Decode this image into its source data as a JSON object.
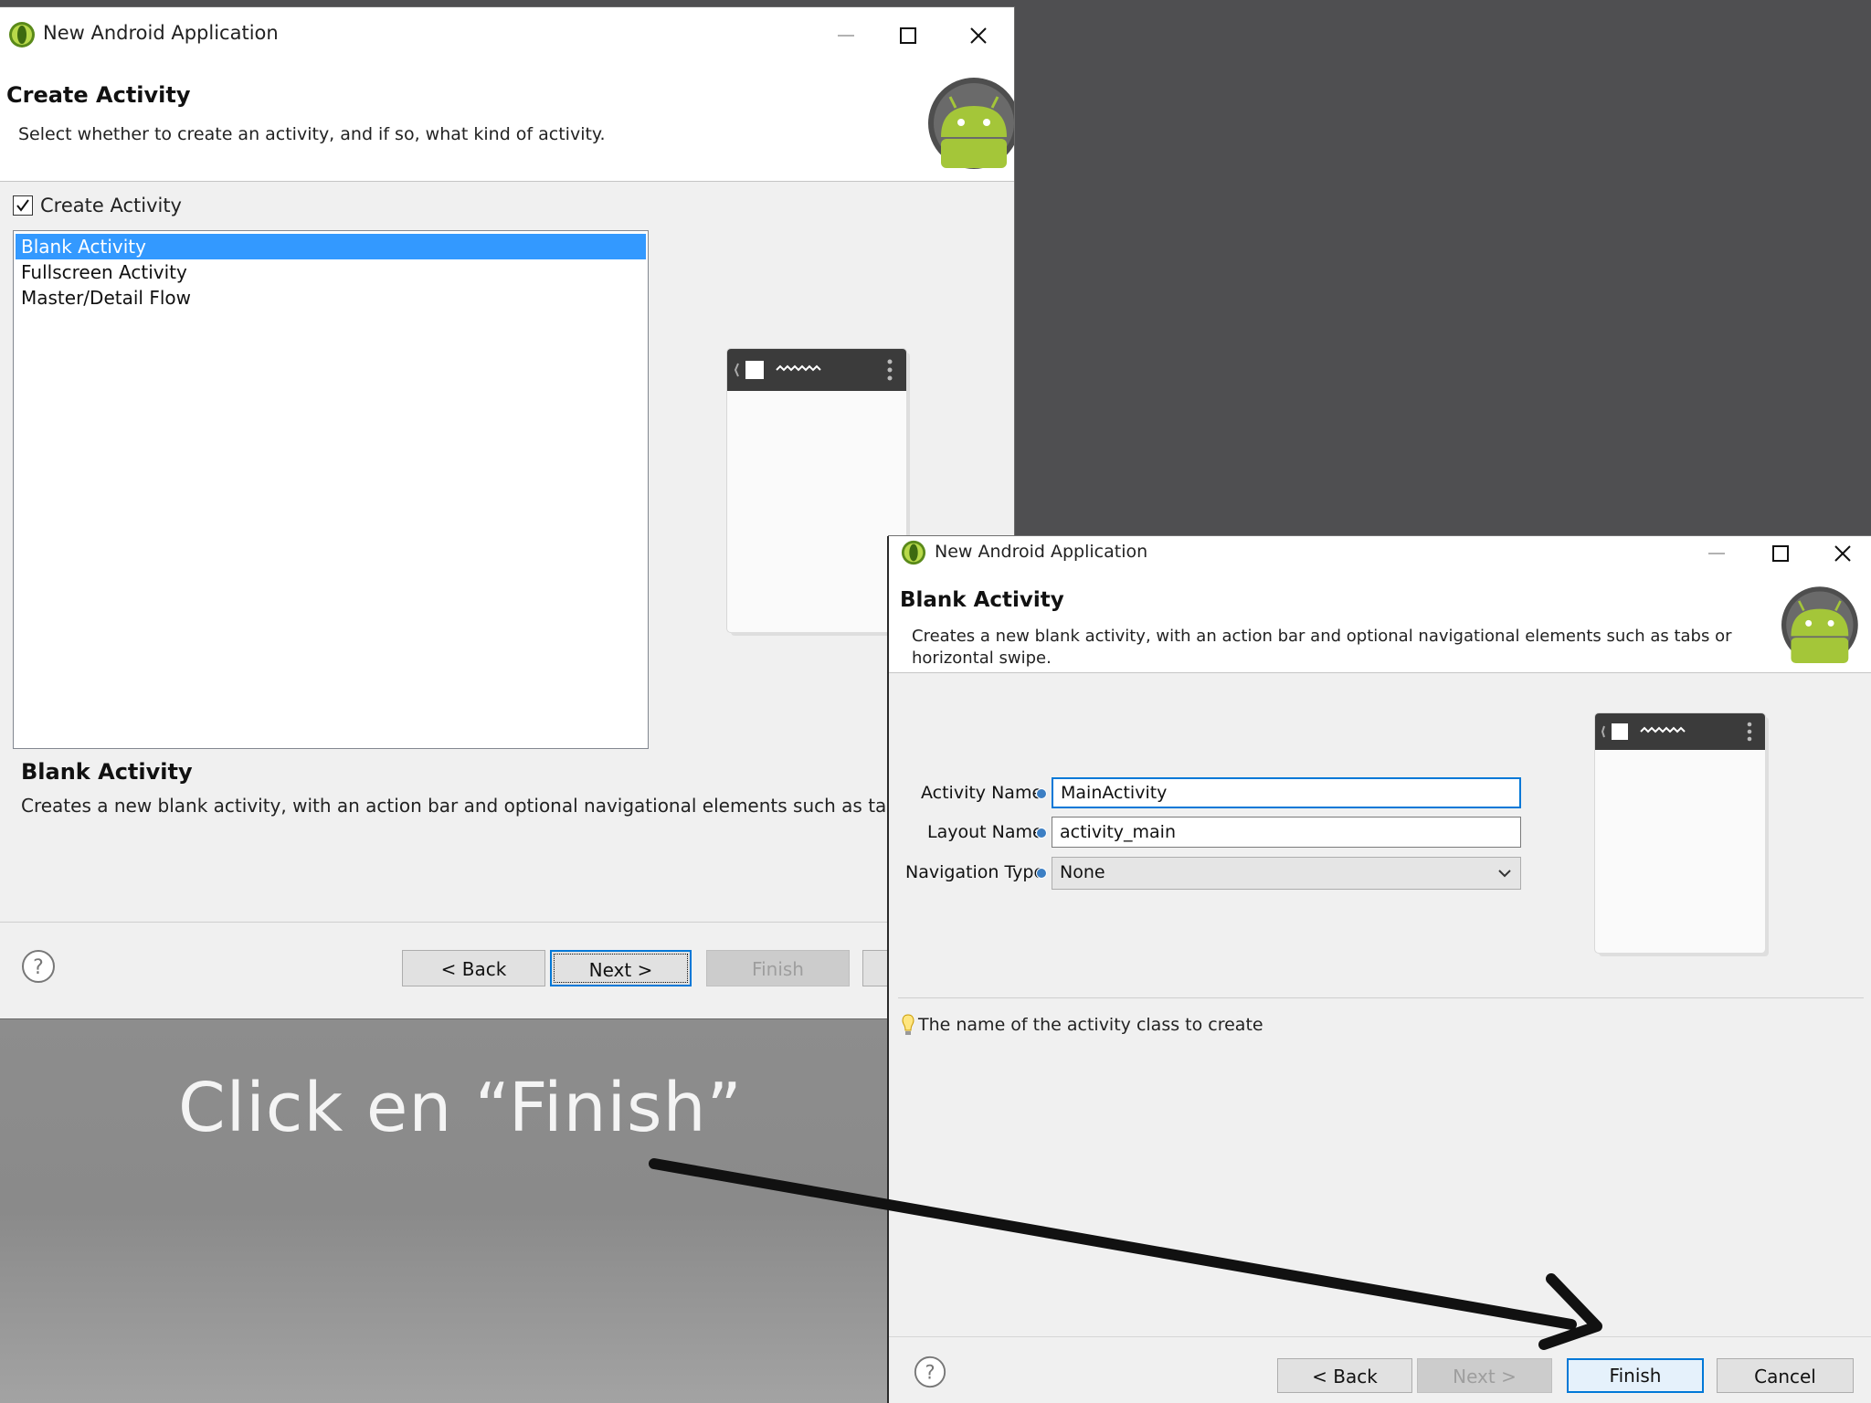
{
  "background": {
    "top_color": "#4f4f51",
    "bottom_color": "#8d8d8d"
  },
  "dialog1": {
    "window_title": "New Android Application",
    "header_title": "Create Activity",
    "header_desc": "Select whether to create an activity, and if so, what kind of activity.",
    "create_activity_checkbox": {
      "label": "Create Activity",
      "checked": true
    },
    "activity_list": [
      {
        "label": "Blank Activity",
        "selected": true
      },
      {
        "label": "Fullscreen Activity",
        "selected": false
      },
      {
        "label": "Master/Detail Flow",
        "selected": false
      }
    ],
    "desc_title": "Blank Activity",
    "desc_text": "Creates a new blank activity, with an action bar and optional navigational elements such as tabs or hori",
    "buttons": {
      "back": "< Back",
      "next": "Next >",
      "finish": "Finish"
    }
  },
  "dialog2": {
    "window_title": "New Android Application",
    "header_title": "Blank Activity",
    "header_desc_line1": "Creates a new blank activity, with an action bar and optional navigational elements such as tabs or",
    "header_desc_line2": "horizontal swipe.",
    "form": {
      "activity_name_label": "Activity Name",
      "activity_name_value": "MainActivity",
      "layout_name_label": "Layout Name",
      "layout_name_value": "activity_main",
      "navigation_type_label": "Navigation Type",
      "navigation_type_value": "None"
    },
    "hint_text": "The name of the activity class to create",
    "buttons": {
      "back": "< Back",
      "next": "Next >",
      "finish": "Finish",
      "cancel": "Cancel"
    }
  },
  "annotation": {
    "caption": "Click en “Finish”",
    "color": "#111111"
  },
  "colors": {
    "selection": "#3399ff",
    "focus": "#0078d7",
    "android_green": "#a4c639"
  }
}
